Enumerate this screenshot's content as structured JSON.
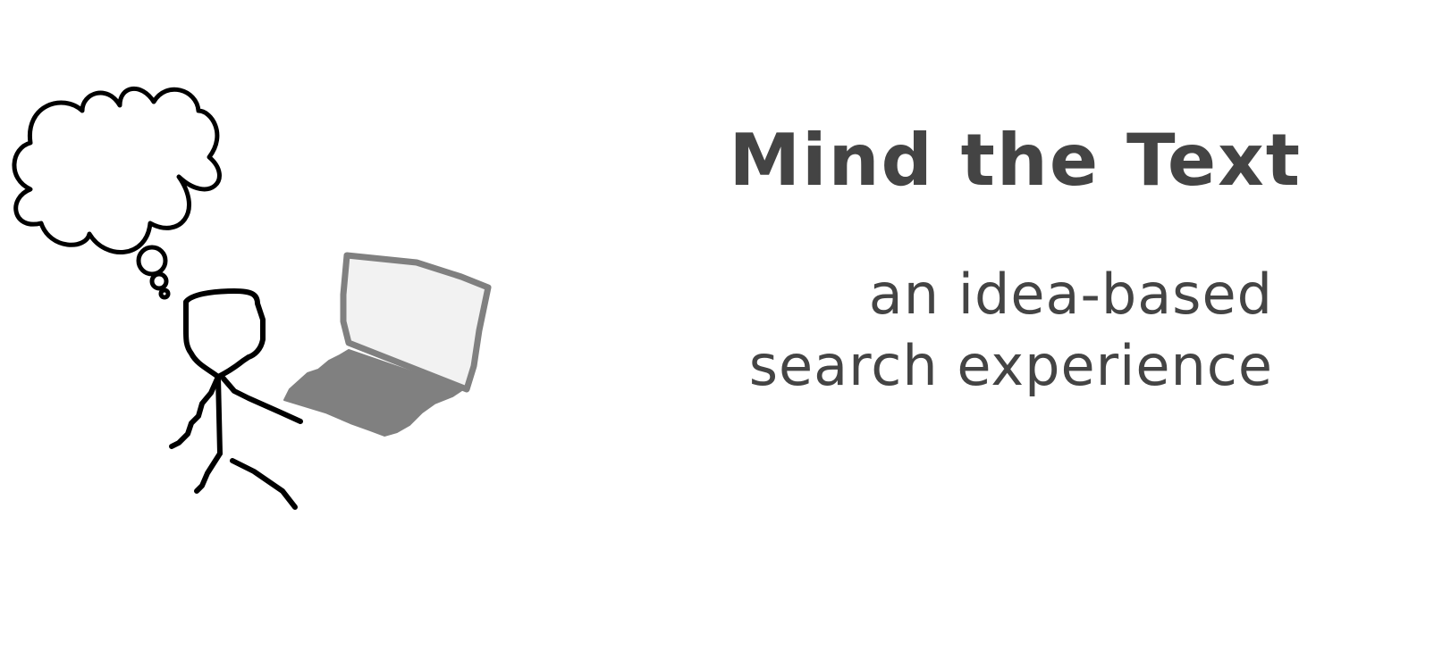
{
  "header": {
    "title": "Mind the Text",
    "subtitle_line1": "an idea-based",
    "subtitle_line2": "search experience"
  },
  "illustration": {
    "figure": "stick-figure",
    "thought": "thought-bubble",
    "device": "laptop-icon"
  },
  "colors": {
    "text": "#444444",
    "stroke": "#000000",
    "laptop_screen": "#f2f2f2",
    "laptop_frame": "#808080",
    "laptop_base": "#808080"
  }
}
